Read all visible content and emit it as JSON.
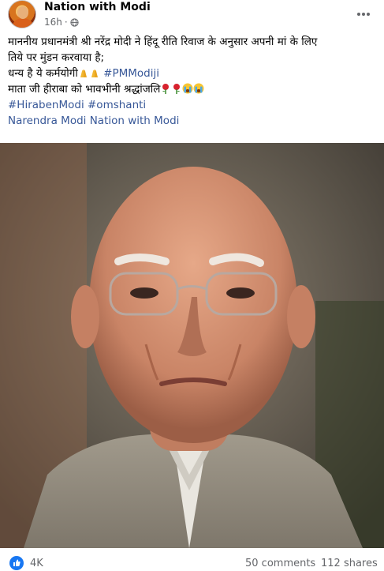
{
  "post": {
    "page_name": "Nation with Modi",
    "time": "16h",
    "text_line1": "माननीय प्रधानमंत्री श्री नरेंद्र मोदी ने हिंदू रीति रिवाज के अनुसार अपनी मां के लिए",
    "text_line2": "तिये पर मुंडन करवाया है;",
    "text_line3": " धन्य है ये कर्मयोगी",
    "hashtag_pmmodiji": "#PMModiji",
    "text_line4": " माता जी हीराबा को भावभीनी श्रद्धांजलि",
    "hashtag_hirabenmodi": "#HirabenModi",
    "hashtag_omshanti": "#omshanti",
    "tag_narendra_modi": "Narendra Modi",
    "tag_nation_with_modi": "Nation with Modi"
  },
  "icons": {
    "privacy": "globe-icon",
    "more": "more-options-icon",
    "reaction": "like-icon",
    "emojis_line3": [
      "folded-hands-emoji",
      "folded-hands-emoji"
    ],
    "emojis_line4": [
      "rose-emoji",
      "rose-emoji",
      "crying-face-emoji",
      "crying-face-emoji"
    ]
  },
  "colors": {
    "link": "#385898",
    "like_blue": "#1877f2",
    "meta_grey": "#65676b"
  },
  "footer": {
    "reactions": "4K",
    "comments": "50 comments",
    "shares": "112 shares"
  }
}
